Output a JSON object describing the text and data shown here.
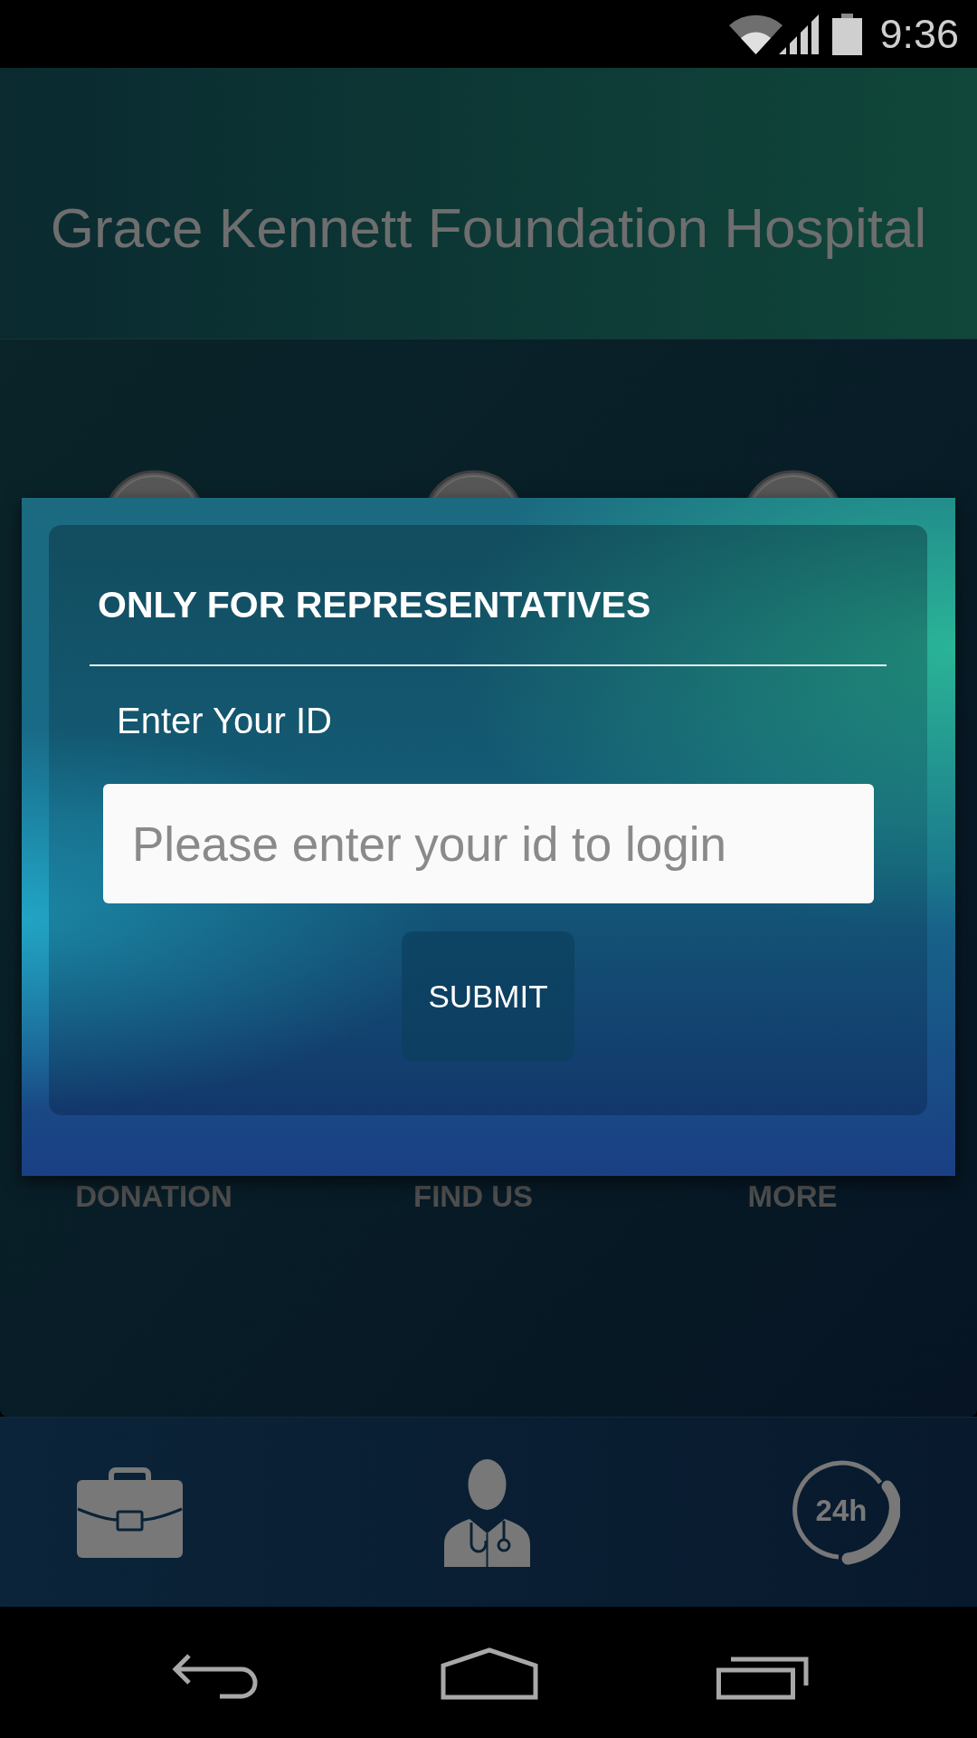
{
  "status_bar": {
    "time": "9:36"
  },
  "header": {
    "title": "Grace Kennett Foundation Hospital"
  },
  "menu": {
    "items": [
      {
        "label": "DONATION"
      },
      {
        "label": "FIND US"
      },
      {
        "label": "MORE"
      }
    ]
  },
  "dialog": {
    "title": "ONLY FOR REPRESENTATIVES",
    "field_label": "Enter Your ID",
    "input": {
      "placeholder": "Please enter your id to login"
    },
    "button": "SUBMIT"
  },
  "bottom_bar": {
    "items": [
      {
        "kind": "briefcase"
      },
      {
        "kind": "doctor"
      },
      {
        "kind": "support",
        "label": "24h"
      }
    ]
  }
}
